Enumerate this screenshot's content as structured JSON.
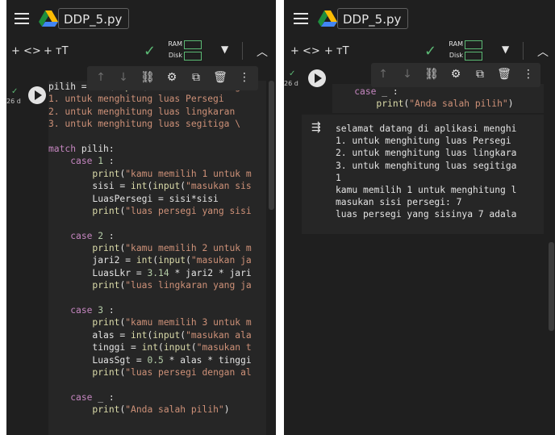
{
  "left_panel": {
    "filename": "DDP_5.py",
    "toolbar": {
      "add_code": "+ <>",
      "add_text": "+ ᴛT",
      "ram_label": "RAM",
      "disk_label": "Disk"
    },
    "cell": {
      "exec_time": "26 d"
    },
    "code_lines": [
      [
        {
          "t": "pilih = ",
          "c": ""
        },
        {
          "t": "int",
          "c": "fn"
        },
        {
          "t": "(",
          "c": ""
        },
        {
          "t": "input",
          "c": "fn"
        },
        {
          "t": "(",
          "c": ""
        },
        {
          "t": "\"\"\"selamat datang",
          "c": "str"
        }
      ],
      [
        {
          "t": "1. untuk menghitung luas Persegi",
          "c": "str"
        }
      ],
      [
        {
          "t": "2. untuk menghitung luas lingkaran",
          "c": "str"
        }
      ],
      [
        {
          "t": "3. untuk menghitung luas segitiga \\",
          "c": "str"
        }
      ],
      [
        {
          "t": "",
          "c": ""
        }
      ],
      [
        {
          "t": "match",
          "c": "kw"
        },
        {
          "t": " pilih:",
          "c": ""
        }
      ],
      [
        {
          "t": "    ",
          "c": ""
        },
        {
          "t": "case",
          "c": "kw"
        },
        {
          "t": " ",
          "c": ""
        },
        {
          "t": "1",
          "c": "num"
        },
        {
          "t": " :",
          "c": ""
        }
      ],
      [
        {
          "t": "        ",
          "c": ""
        },
        {
          "t": "print",
          "c": "fn"
        },
        {
          "t": "(",
          "c": ""
        },
        {
          "t": "\"kamu memilih 1 untuk m",
          "c": "str"
        }
      ],
      [
        {
          "t": "        sisi = ",
          "c": ""
        },
        {
          "t": "int",
          "c": "fn"
        },
        {
          "t": "(",
          "c": ""
        },
        {
          "t": "input",
          "c": "fn"
        },
        {
          "t": "(",
          "c": ""
        },
        {
          "t": "\"masukan sis",
          "c": "str"
        }
      ],
      [
        {
          "t": "        LuasPersegi = sisi*sisi",
          "c": ""
        }
      ],
      [
        {
          "t": "        ",
          "c": ""
        },
        {
          "t": "print",
          "c": "fn"
        },
        {
          "t": "(",
          "c": ""
        },
        {
          "t": "\"luas persegi yang sisi",
          "c": "str"
        }
      ],
      [
        {
          "t": "",
          "c": ""
        }
      ],
      [
        {
          "t": "    ",
          "c": ""
        },
        {
          "t": "case",
          "c": "kw"
        },
        {
          "t": " ",
          "c": ""
        },
        {
          "t": "2",
          "c": "num"
        },
        {
          "t": " :",
          "c": ""
        }
      ],
      [
        {
          "t": "        ",
          "c": ""
        },
        {
          "t": "print",
          "c": "fn"
        },
        {
          "t": "(",
          "c": ""
        },
        {
          "t": "\"kamu memilih 2 untuk m",
          "c": "str"
        }
      ],
      [
        {
          "t": "        jari2 = ",
          "c": ""
        },
        {
          "t": "int",
          "c": "fn"
        },
        {
          "t": "(",
          "c": ""
        },
        {
          "t": "input",
          "c": "fn"
        },
        {
          "t": "(",
          "c": ""
        },
        {
          "t": "\"masukan ja",
          "c": "str"
        }
      ],
      [
        {
          "t": "        LuasLkr = ",
          "c": ""
        },
        {
          "t": "3.14",
          "c": "num"
        },
        {
          "t": " * jari2 * jari",
          "c": ""
        }
      ],
      [
        {
          "t": "        ",
          "c": ""
        },
        {
          "t": "print",
          "c": "fn"
        },
        {
          "t": "(",
          "c": ""
        },
        {
          "t": "\"luas lingkaran yang ja",
          "c": "str"
        }
      ],
      [
        {
          "t": "",
          "c": ""
        }
      ],
      [
        {
          "t": "    ",
          "c": ""
        },
        {
          "t": "case",
          "c": "kw"
        },
        {
          "t": " ",
          "c": ""
        },
        {
          "t": "3",
          "c": "num"
        },
        {
          "t": " :",
          "c": ""
        }
      ],
      [
        {
          "t": "        ",
          "c": ""
        },
        {
          "t": "print",
          "c": "fn"
        },
        {
          "t": "(",
          "c": ""
        },
        {
          "t": "\"kamu memilih 3 untuk m",
          "c": "str"
        }
      ],
      [
        {
          "t": "        alas = ",
          "c": ""
        },
        {
          "t": "int",
          "c": "fn"
        },
        {
          "t": "(",
          "c": ""
        },
        {
          "t": "input",
          "c": "fn"
        },
        {
          "t": "(",
          "c": ""
        },
        {
          "t": "\"masukan ala",
          "c": "str"
        }
      ],
      [
        {
          "t": "        tinggi = ",
          "c": ""
        },
        {
          "t": "int",
          "c": "fn"
        },
        {
          "t": "(",
          "c": ""
        },
        {
          "t": "input",
          "c": "fn"
        },
        {
          "t": "(",
          "c": ""
        },
        {
          "t": "\"masukan t",
          "c": "str"
        }
      ],
      [
        {
          "t": "        LuasSgt = ",
          "c": ""
        },
        {
          "t": "0.5",
          "c": "num"
        },
        {
          "t": " * alas * tinggi",
          "c": ""
        }
      ],
      [
        {
          "t": "        ",
          "c": ""
        },
        {
          "t": "print",
          "c": "fn"
        },
        {
          "t": "(",
          "c": ""
        },
        {
          "t": "\"luas persegi dengan al",
          "c": "str"
        }
      ],
      [
        {
          "t": "",
          "c": ""
        }
      ],
      [
        {
          "t": "    ",
          "c": ""
        },
        {
          "t": "case",
          "c": "kw"
        },
        {
          "t": " _ :",
          "c": ""
        }
      ],
      [
        {
          "t": "        ",
          "c": ""
        },
        {
          "t": "print",
          "c": "fn"
        },
        {
          "t": "(",
          "c": ""
        },
        {
          "t": "\"Anda salah pilih\"",
          "c": "str"
        },
        {
          "t": ")",
          "c": ""
        }
      ]
    ]
  },
  "right_panel": {
    "filename": "DDP_5.py",
    "toolbar": {
      "add_code": "+ <>",
      "add_text": "+ ᴛT",
      "ram_label": "RAM",
      "disk_label": "Disk"
    },
    "cell": {
      "exec_time": "26 d"
    },
    "code_lines": [
      [
        {
          "t": "    ",
          "c": ""
        },
        {
          "t": "case",
          "c": "kw"
        },
        {
          "t": " _ :",
          "c": ""
        }
      ],
      [
        {
          "t": "        ",
          "c": ""
        },
        {
          "t": "print",
          "c": "fn"
        },
        {
          "t": "(",
          "c": ""
        },
        {
          "t": "\"Anda salah pilih\"",
          "c": "str"
        },
        {
          "t": ")",
          "c": ""
        }
      ]
    ],
    "output_lines": [
      "selamat datang di aplikasi menghi",
      "1. untuk menghitung luas Persegi",
      "2. untuk menghitung luas lingkara",
      "3. untuk menghitung luas segitiga",
      "1",
      "kamu memilih 1 untuk menghitung l",
      "masukan sisi persegi: 7",
      "luas persegi yang sisinya 7 adala"
    ]
  },
  "colors": {
    "background": "#1f1f1f",
    "code_bg": "#262626",
    "keyword": "#c586c0",
    "function": "#dcdcaa",
    "string": "#ce9178",
    "number": "#b5cea8",
    "ok_green": "#5bb974"
  },
  "icons": [
    "menu-icon",
    "drive-logo-icon",
    "check-icon",
    "dropdown-icon",
    "collapse-icon",
    "arrow-up-icon",
    "arrow-down-icon",
    "link-icon",
    "gear-icon",
    "mirror-cell-icon",
    "delete-icon",
    "more-icon",
    "run-icon",
    "output-icon"
  ]
}
